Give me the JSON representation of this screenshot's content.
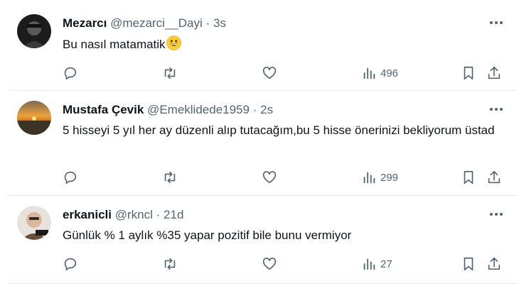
{
  "tweets": [
    {
      "name": "Mezarcı",
      "handle": "@mezarci__Dayi",
      "separator": "·",
      "time": "3s",
      "text": "Bu nasıl matamatik",
      "emoji": "grinning-face-emoji",
      "views": "496",
      "avatar_colors": [
        "#1c1c1c",
        "#3a3a3a"
      ]
    },
    {
      "name": "Mustafa Çevik",
      "handle": "@Emeklidede1959",
      "separator": "·",
      "time": "2s",
      "text": "5 hisseyi 5 yıl her ay düzenli alıp tutacağım,bu 5 hisse önerinizi bekliyorum üstad",
      "views": "299",
      "avatar_colors": [
        "#f2a23a",
        "#3b3325"
      ]
    },
    {
      "name": "erkanicli",
      "handle": "@rkncl",
      "separator": "·",
      "time": "21d",
      "text": "Günlük % 1 aylık %35 yapar pozitif bile bunu vermiyor",
      "views": "27",
      "avatar_colors": [
        "#d9c2b0",
        "#6b4e3a"
      ]
    }
  ],
  "icons": {
    "reply": "reply-icon",
    "retweet": "retweet-icon",
    "like": "like-icon",
    "views": "views-icon",
    "bookmark": "bookmark-icon",
    "share": "share-icon",
    "more": "more-icon"
  },
  "colors": {
    "text": "#0f1419",
    "muted": "#536471",
    "divider": "#e7e9ea",
    "emoji": "#ffcc33"
  }
}
